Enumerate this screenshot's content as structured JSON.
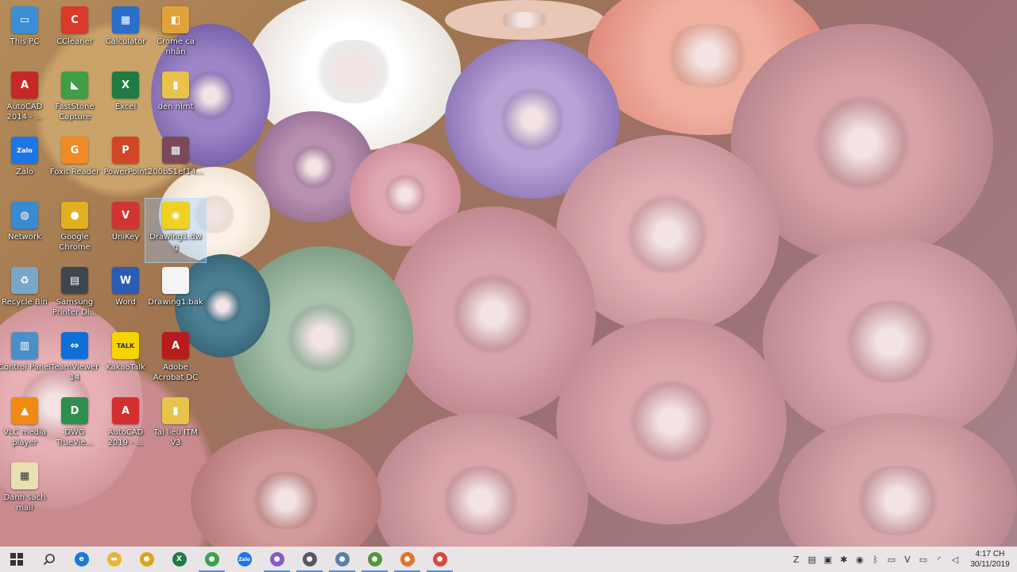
{
  "desktop": {
    "icons": [
      {
        "label": "This PC",
        "icon": "this-pc-icon",
        "color": "#3b8fd8",
        "glyph": "▭"
      },
      {
        "label": "CCleaner",
        "icon": "ccleaner-icon",
        "color": "#d93a2b",
        "glyph": "C"
      },
      {
        "label": "Calculator",
        "icon": "calculator-icon",
        "color": "#2a6fc9",
        "glyph": "▦"
      },
      {
        "label": "Crome ca\nnhân",
        "icon": "chrome-shortcut-icon",
        "color": "#e1a23a",
        "glyph": "◧"
      },
      {
        "label": "AutoCAD\n2014 - ...",
        "icon": "autocad-2014-icon",
        "color": "#c62828",
        "glyph": "A"
      },
      {
        "label": "FastStone\nCapture",
        "icon": "faststone-capture-icon",
        "color": "#3e9d45",
        "glyph": "◣"
      },
      {
        "label": "Excel",
        "icon": "excel-icon",
        "color": "#1f7a43",
        "glyph": "X"
      },
      {
        "label": "den nlmt",
        "icon": "folder-zip-icon",
        "color": "#e8c34a",
        "glyph": "▮"
      },
      {
        "label": "Zalo",
        "icon": "zalo-icon",
        "color": "#1d76e5",
        "glyph": "Zalo"
      },
      {
        "label": "Foxit Reader",
        "icon": "foxit-reader-icon",
        "color": "#f08a24",
        "glyph": "G"
      },
      {
        "label": "PowerPoint",
        "icon": "powerpoint-icon",
        "color": "#d24625",
        "glyph": "P"
      },
      {
        "label": "200b51ef14...",
        "icon": "image-file-icon",
        "color": "#7a4a5a",
        "glyph": "▩"
      },
      {
        "label": "Network",
        "icon": "network-icon",
        "color": "#3a8ad0",
        "glyph": "◍"
      },
      {
        "label": "Google\nChrome",
        "icon": "google-chrome-icon",
        "color": "#e0b020",
        "glyph": "●"
      },
      {
        "label": "UniKey",
        "icon": "unikey-icon",
        "color": "#d23434",
        "glyph": "V"
      },
      {
        "label": "Drawing1.dw\ng",
        "icon": "dwg-file-icon",
        "color": "#f0d020",
        "glyph": "◉"
      },
      {
        "label": "Recycle Bin",
        "icon": "recycle-bin-icon",
        "color": "#7aa7c9",
        "glyph": "♻"
      },
      {
        "label": "Samsung\nPrinter Di...",
        "icon": "samsung-printer-icon",
        "color": "#3d4750",
        "glyph": "▤"
      },
      {
        "label": "Word",
        "icon": "word-icon",
        "color": "#2b5cb5",
        "glyph": "W"
      },
      {
        "label": "Drawing1.bak",
        "icon": "blank-file-icon",
        "color": "#f4f4f4",
        "glyph": ""
      },
      {
        "label": "Control Panel",
        "icon": "control-panel-icon",
        "color": "#4a90c8",
        "glyph": "▥"
      },
      {
        "label": "TeamViewer\n14",
        "icon": "teamviewer-icon",
        "color": "#0e6fd8",
        "glyph": "⇔"
      },
      {
        "label": "KakaoTalk",
        "icon": "kakaotalk-icon",
        "color": "#f6d400",
        "glyph": "TALK"
      },
      {
        "label": "Adobe\nAcrobat DC",
        "icon": "adobe-acrobat-icon",
        "color": "#b71c1c",
        "glyph": "A"
      },
      {
        "label": "VLC media\nplayer",
        "icon": "vlc-icon",
        "color": "#f08a12",
        "glyph": "▲"
      },
      {
        "label": "DWG\nTrueVie...",
        "icon": "dwg-trueview-icon",
        "color": "#2f8f4e",
        "glyph": "D"
      },
      {
        "label": "AutoCAD\n2019 - ...",
        "icon": "autocad-2019-icon",
        "color": "#d32f2f",
        "glyph": "A"
      },
      {
        "label": "Tai lieu ITM\nV3",
        "icon": "folder-doc-icon",
        "color": "#e6c44c",
        "glyph": "▮"
      },
      {
        "label": "Danh sach\nmail",
        "icon": "excel-file-icon",
        "color": "#e8e0b0",
        "glyph": "▦"
      }
    ]
  },
  "taskbar": {
    "start": "windows-start-icon",
    "search": "search-icon",
    "apps": [
      {
        "icon": "edge-icon",
        "color": "#1e78d4",
        "glyph": "e",
        "active": false
      },
      {
        "icon": "file-explorer-icon",
        "color": "#e8b53a",
        "glyph": "▬",
        "active": false
      },
      {
        "icon": "chrome-icon",
        "color": "#dba41a",
        "glyph": "●",
        "active": false
      },
      {
        "icon": "excel-taskbar-icon",
        "color": "#1f7a43",
        "glyph": "X",
        "active": false
      },
      {
        "icon": "chrome-profile-1-icon",
        "color": "#3aa24a",
        "glyph": "●",
        "active": true
      },
      {
        "icon": "zalo-taskbar-icon",
        "color": "#1d76e5",
        "glyph": "Zalo",
        "active": false
      },
      {
        "icon": "chrome-profile-2-icon",
        "color": "#8a5ac4",
        "glyph": "●",
        "active": true
      },
      {
        "icon": "chrome-profile-3-icon",
        "color": "#555a60",
        "glyph": "●",
        "active": true
      },
      {
        "icon": "chrome-profile-4-icon",
        "color": "#5a7fa8",
        "glyph": "●",
        "active": true
      },
      {
        "icon": "chrome-profile-5-icon",
        "color": "#4a9a3a",
        "glyph": "●",
        "active": true
      },
      {
        "icon": "chrome-profile-6-icon",
        "color": "#e2732a",
        "glyph": "●",
        "active": true
      },
      {
        "icon": "chrome-profile-7-icon",
        "color": "#d84a3a",
        "glyph": "●",
        "active": true
      }
    ],
    "tray": [
      {
        "icon": "zalo-tray-icon",
        "glyph": "Z"
      },
      {
        "icon": "printer-tray-icon",
        "glyph": "▤"
      },
      {
        "icon": "display-tray-icon",
        "glyph": "▣"
      },
      {
        "icon": "bluetooth-settings-tray-icon",
        "glyph": "✱"
      },
      {
        "icon": "chat-tray-icon",
        "glyph": "◉"
      },
      {
        "icon": "bluetooth-icon",
        "glyph": "ᛒ"
      },
      {
        "icon": "keyboard-tray-icon",
        "glyph": "▭"
      },
      {
        "icon": "unikey-tray-icon",
        "glyph": "V"
      },
      {
        "icon": "battery-icon",
        "glyph": "▭"
      },
      {
        "icon": "wifi-icon",
        "glyph": "◜"
      },
      {
        "icon": "volume-icon",
        "glyph": "◁"
      }
    ],
    "clock": {
      "time": "4:17 CH",
      "date": "30/11/2019"
    }
  }
}
